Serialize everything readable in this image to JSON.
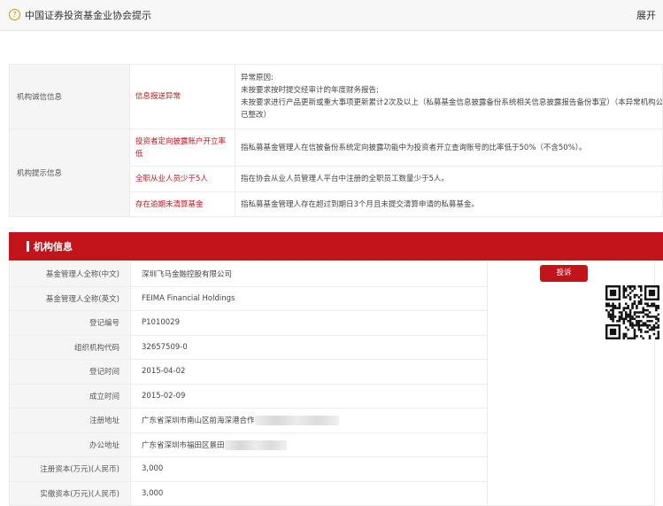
{
  "header": {
    "icon": "question-circle-icon",
    "title": "中国证券投资基金业协会提示",
    "expand_label": "展开"
  },
  "alerts": {
    "integrity_category": "机构诚信信息",
    "integrity_type": "信息报送异常",
    "integrity_lines": [
      "异常原因:",
      "未按要求按时提交经审计的年度财务报告;",
      "未按要求进行产品更新或重大事项更新累计2次及以上（私募基金信息披露备份系统相关信息披露报告备份事宜）（本异常机构公示情形",
      "已整改）"
    ],
    "hint_category": "机构提示信息",
    "hints": [
      {
        "type": "投资者定向披露账户开立率低",
        "desc": "指私募基金管理人在信披备份系统定向披露功能中为投资者开立查询账号的比率低于50%（不含50%）。"
      },
      {
        "type": "全职从业人员少于5人",
        "desc": "指在协会从业人员管理人平台中注册的全职员工数量少于5人。"
      },
      {
        "type": "存在逾期未清算基金",
        "desc": "指私募基金管理人存在超过到期日3个月且未提交清算申请的私募基金。"
      }
    ]
  },
  "org_info": {
    "section_title": "机构信息",
    "complaint_label": "投诉",
    "rows": [
      {
        "label": "基金管理人全称(中文)",
        "value": "深圳飞马金融控股有限公司"
      },
      {
        "label": "基金管理人全称(英文)",
        "value": "FEIMA Financial Holdings"
      },
      {
        "label": "登记编号",
        "value": "P1010029"
      },
      {
        "label": "组织机构代码",
        "value": "32657509-0"
      },
      {
        "label": "登记时间",
        "value": "2015-04-02"
      },
      {
        "label": "成立时间",
        "value": "2015-02-09"
      },
      {
        "label": "注册地址",
        "value": "广东省深圳市南山区前海深港合作"
      },
      {
        "label": "办公地址",
        "value": "广东省深圳市福田区景田"
      },
      {
        "label": "注册资本(万元)(人民币)",
        "value": "3,000"
      },
      {
        "label": "实缴资本(万元)(人民币)",
        "value": "3,000"
      }
    ]
  },
  "colors": {
    "brand_red": "#c3141c",
    "label_bg": "#f5f5f5",
    "topbar_bg": "#f7f7f7"
  }
}
